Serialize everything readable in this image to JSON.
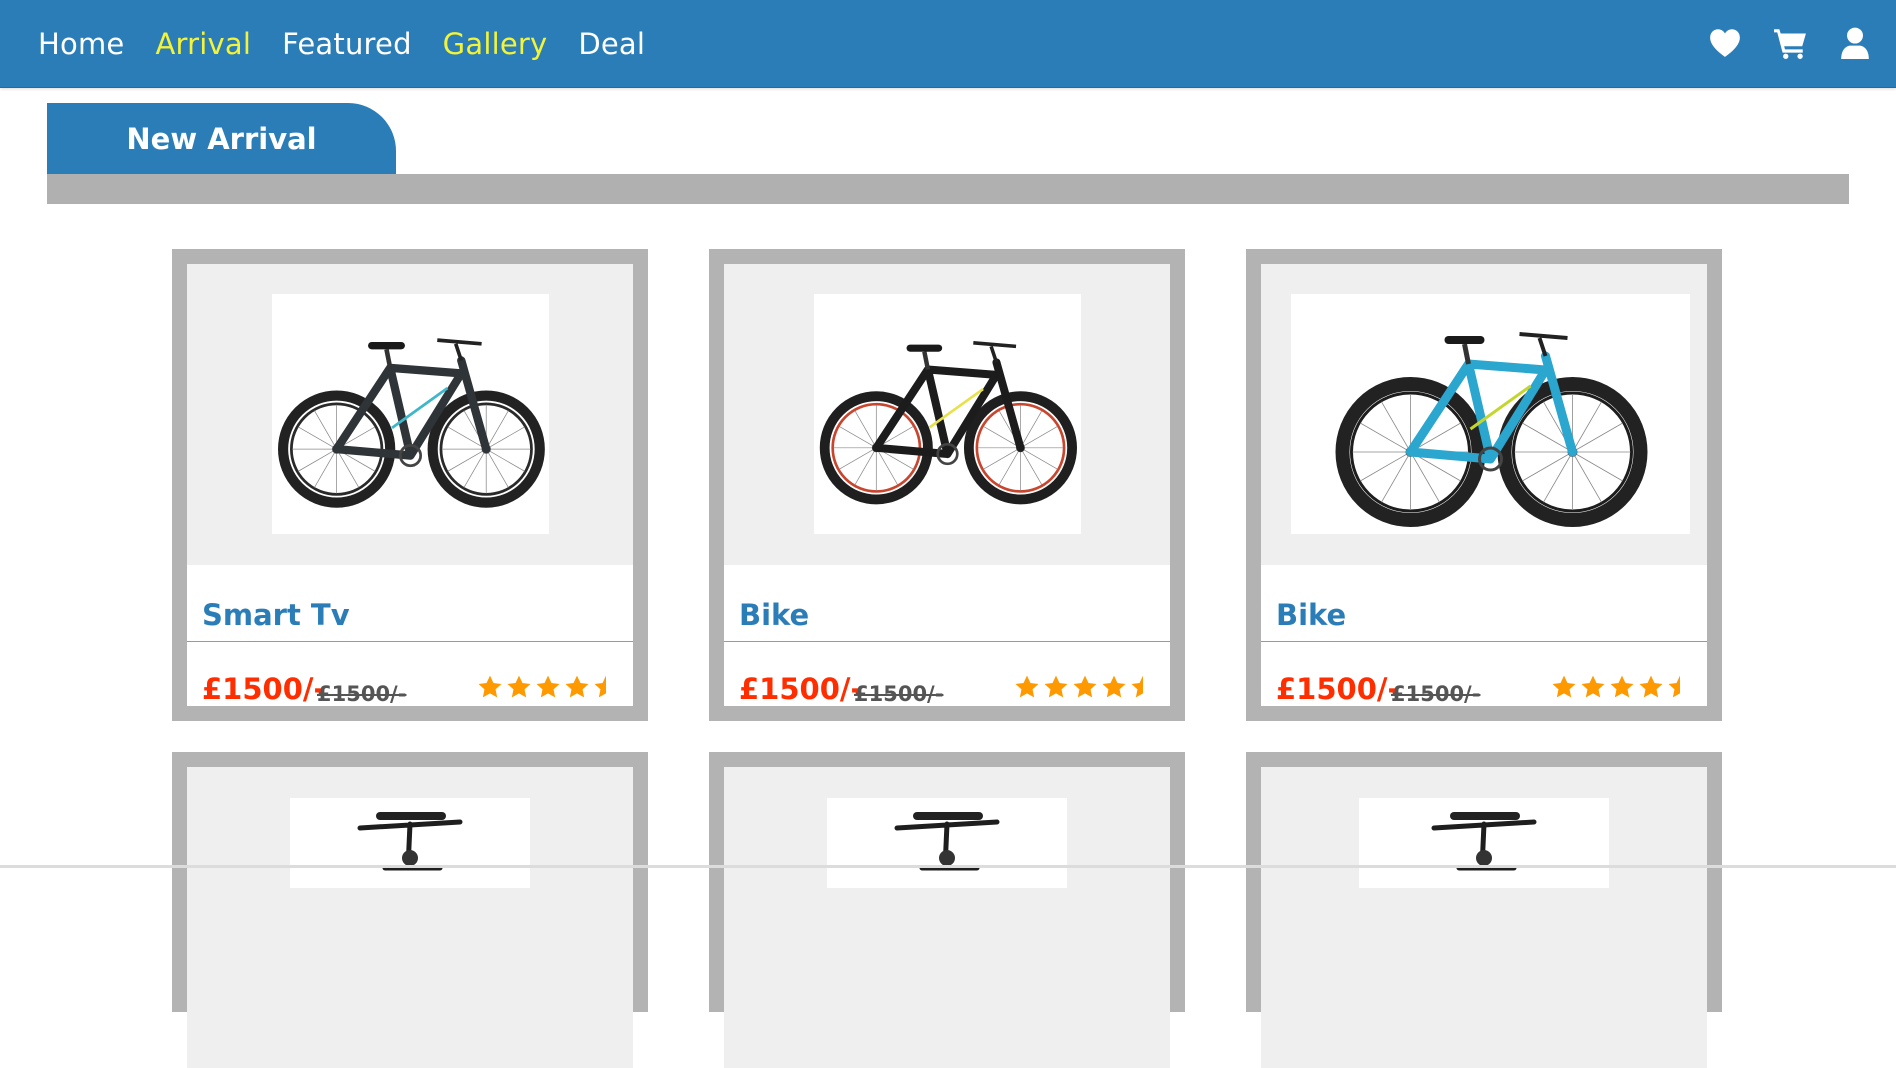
{
  "nav": {
    "links": [
      "Home",
      "Arrival",
      "Featured",
      "Gallery",
      "Deal"
    ],
    "highlighted": [
      "Arrival",
      "Gallery"
    ],
    "icons": [
      "heart-icon",
      "cart-icon",
      "user-icon"
    ]
  },
  "section": {
    "title": "New Arrival"
  },
  "products": [
    {
      "title": "Smart Tv",
      "price": "£1500/-",
      "old_price": "£1500/-",
      "rating": 4.5,
      "bike_color": "dark-gray"
    },
    {
      "title": "Bike",
      "price": "£1500/-",
      "old_price": "£1500/-",
      "rating": 4.5,
      "bike_color": "black-red"
    },
    {
      "title": "Bike",
      "price": "£1500/-",
      "old_price": "£1500/-",
      "rating": 4.5,
      "bike_color": "cyan"
    }
  ],
  "colors": {
    "brand_blue": "#2b7db8",
    "nav_highlight": "#f3f338",
    "price_red": "#ff2e00",
    "star_orange": "#ff9900",
    "card_border": "#b3b3b3"
  }
}
